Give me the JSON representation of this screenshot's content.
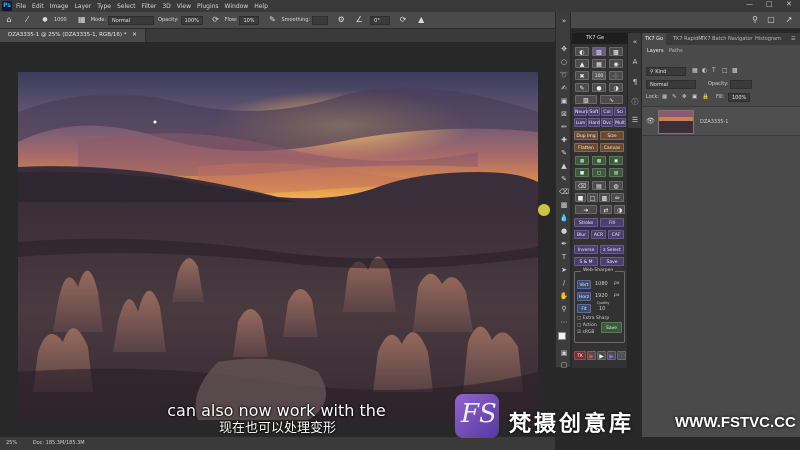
{
  "menubar": {
    "logo": "Ps",
    "items": [
      "File",
      "Edit",
      "Image",
      "Layer",
      "Type",
      "Select",
      "Filter",
      "3D",
      "View",
      "Plugins",
      "Window",
      "Help"
    ]
  },
  "options": {
    "size": "1000",
    "mode_label": "Mode:",
    "mode_value": "Normal",
    "opacity_label": "Opacity:",
    "opacity_value": "100%",
    "flow_label": "Flow:",
    "flow_value": "10%",
    "smoothing_label": "Smoothing:",
    "smoothing_value": "",
    "angle_value": "0°"
  },
  "document": {
    "tab_title": "DZA3335-1 @ 25% (DZA3335-1, RGB/16) *",
    "zoom": "25%",
    "doc_info": "Doc: 185.3M/185.3M"
  },
  "tk7": {
    "title": "TK7 Ge",
    "buttons": {
      "hundred": "100",
      "neuro": "Neuro",
      "soft": "Soft",
      "col": "Col",
      "sci": "Sci",
      "lum": "Lum",
      "hard": "Hard",
      "dvc": "Dvc",
      "mult": "Mult",
      "dup_img": "Dup Img",
      "size": "Size",
      "flatten": "Flatten",
      "canvas": "Canvas",
      "stroke": "Stroke",
      "fill": "Fill",
      "blur": "Blur",
      "acr": "ACR",
      "caf": "CAF",
      "inverse": "Inverse",
      "z_select": "z Select",
      "s_m": "S & M",
      "save": "Save",
      "web_sharpen": "Web-Sharpen",
      "vert": "Vert",
      "vert_val": "1080",
      "horz": "Horz",
      "horz_val": "1920",
      "px": "px",
      "fit": "Fit",
      "quality_label": "Quality",
      "quality_val": "10",
      "extra_sharp": "Extra Sharp",
      "action": "Action",
      "srgb": "sRGB",
      "save2": "Save",
      "tk": "TK"
    }
  },
  "panels": {
    "tabs": [
      "TK7 Go",
      "TK7 RapidM",
      "TK7 Batch",
      "Navigator",
      "Histogram"
    ],
    "sub_tabs": [
      "Layers",
      "Paths"
    ],
    "kind_label": "Kind",
    "blend_mode": "Normal",
    "opacity_label": "Opacity:",
    "opacity_value": "",
    "lock_label": "Lock:",
    "fill_label": "Fill:",
    "fill_value": "100%",
    "layer_name": "DZA3335-1"
  },
  "subtitles": {
    "en": "can also now work with the",
    "zh": "现在也可以处理变形"
  },
  "watermark": {
    "logo_text": "FS",
    "name": "梵摄创意库",
    "url": "WWW.FSTVC.CC"
  },
  "colors": {
    "ps_blue": "#31a8ff",
    "cursor_yellow": "#e8e040",
    "watermark_purple": "#7a4cc8"
  }
}
